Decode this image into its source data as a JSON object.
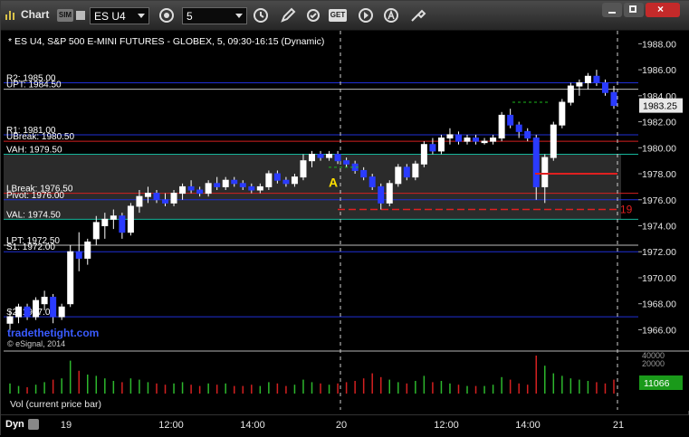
{
  "toolbar": {
    "title": "Chart",
    "symbol": "ES U4",
    "interval": "5",
    "icons": [
      "chart-icon",
      "sim-icon",
      "link-icon",
      "settings-gear-icon",
      "clock-icon",
      "pencil-icon",
      "refresh-icon",
      "get-icon",
      "play-icon",
      "alert-icon",
      "tools-icon"
    ],
    "sim_label": "SIM",
    "get_label": "GET"
  },
  "chart_data": [
    {
      "type": "candlestick",
      "title": "* ES U4, S&P 500 E-MINI FUTURES - GLOBEX, 5, 09:30-16:15 (Dynamic)",
      "last_price": "1983.25",
      "ylim": [
        1964.5,
        1989
      ],
      "y_ticks": [
        "1988.00",
        "1986.00",
        "1984.00",
        "1982.00",
        "1980.00",
        "1978.00",
        "1976.00",
        "1974.00",
        "1972.00",
        "1970.00",
        "1968.00",
        "1966.00"
      ],
      "x_ticks": [
        "19",
        "12:00",
        "14:00",
        "20",
        "12:00",
        "14:00",
        "21"
      ],
      "watermark": "tradethetight.com",
      "copyright": "© eSignal, 2014",
      "levels": [
        {
          "label": "R2: 1985.00",
          "price": 1985.0,
          "color": "#1f2fd6"
        },
        {
          "label": "UPT: 1984.50",
          "price": 1984.5,
          "color": "#bdbdbd"
        },
        {
          "label": "R1: 1981.00",
          "price": 1981.0,
          "color": "#1f2fd6"
        },
        {
          "label": "UBreak: 1980.50",
          "price": 1980.5,
          "color": "#d42020"
        },
        {
          "label": "VAH: 1979.50",
          "price": 1979.5,
          "color": "#16b49a"
        },
        {
          "label": "LBreak: 1976.50",
          "price": 1976.5,
          "color": "#d42020"
        },
        {
          "label": "Pivot: 1976.00",
          "price": 1976.0,
          "color": "#1f2fd6"
        },
        {
          "label": "VAL: 1974.50",
          "price": 1974.5,
          "color": "#16b49a"
        },
        {
          "label": "LPT: 1972.50",
          "price": 1972.5,
          "color": "#bdbdbd"
        },
        {
          "label": "S1: 1972.00",
          "price": 1972.0,
          "color": "#1f2fd6"
        },
        {
          "label": "S2: 1967.00",
          "price": 1967.0,
          "color": "#1f2fd6"
        }
      ],
      "value_area": [
        1974.5,
        1979.5
      ],
      "dashed_level_label": "19",
      "dashed_level_price": 1975.25,
      "annotation_A": "A",
      "candles": [
        [
          1966.5,
          1967.5,
          1966.0,
          1967.0
        ],
        [
          1967.0,
          1968.0,
          1966.5,
          1967.75
        ],
        [
          1967.75,
          1968.0,
          1966.75,
          1967.0
        ],
        [
          1967.0,
          1968.5,
          1966.75,
          1968.25
        ],
        [
          1968.0,
          1969.0,
          1967.5,
          1968.5
        ],
        [
          1968.5,
          1968.75,
          1966.5,
          1967.0
        ],
        [
          1967.0,
          1968.0,
          1966.75,
          1967.75
        ],
        [
          1968.0,
          1972.5,
          1967.75,
          1972.0
        ],
        [
          1972.0,
          1973.5,
          1970.5,
          1971.5
        ],
        [
          1971.5,
          1973.0,
          1971.0,
          1972.75
        ],
        [
          1973.0,
          1974.75,
          1972.5,
          1974.25
        ],
        [
          1974.0,
          1975.0,
          1973.0,
          1974.5
        ],
        [
          1974.5,
          1975.25,
          1973.75,
          1974.75
        ],
        [
          1974.75,
          1975.0,
          1973.0,
          1973.5
        ],
        [
          1973.5,
          1975.75,
          1973.25,
          1975.5
        ],
        [
          1975.5,
          1976.75,
          1975.0,
          1976.25
        ],
        [
          1976.25,
          1977.0,
          1975.75,
          1976.5
        ],
        [
          1976.5,
          1976.75,
          1975.75,
          1976.0
        ],
        [
          1976.0,
          1976.5,
          1975.5,
          1975.75
        ],
        [
          1975.75,
          1976.75,
          1975.5,
          1976.5
        ],
        [
          1976.5,
          1977.25,
          1976.0,
          1977.0
        ],
        [
          1977.0,
          1977.5,
          1976.5,
          1976.75
        ],
        [
          1976.75,
          1977.0,
          1976.25,
          1976.5
        ],
        [
          1976.5,
          1977.5,
          1976.25,
          1977.25
        ],
        [
          1977.25,
          1977.75,
          1976.75,
          1977.0
        ],
        [
          1977.0,
          1977.75,
          1976.75,
          1977.5
        ],
        [
          1977.5,
          1977.75,
          1977.0,
          1977.25
        ],
        [
          1977.25,
          1977.5,
          1976.75,
          1977.0
        ],
        [
          1977.0,
          1977.25,
          1976.5,
          1976.75
        ],
        [
          1976.75,
          1977.25,
          1976.5,
          1977.0
        ],
        [
          1977.0,
          1978.25,
          1976.75,
          1978.0
        ],
        [
          1978.0,
          1978.25,
          1977.25,
          1977.5
        ],
        [
          1977.5,
          1977.75,
          1977.0,
          1977.25
        ],
        [
          1977.25,
          1978.0,
          1977.0,
          1977.75
        ],
        [
          1977.75,
          1979.5,
          1977.5,
          1979.0
        ],
        [
          1979.0,
          1979.75,
          1978.5,
          1979.5
        ],
        [
          1979.5,
          1979.75,
          1979.0,
          1979.25
        ],
        [
          1979.25,
          1979.75,
          1979.0,
          1979.5
        ],
        [
          1979.5,
          1979.75,
          1978.75,
          1979.0
        ],
        [
          1979.0,
          1979.25,
          1978.5,
          1978.75
        ],
        [
          1978.75,
          1979.0,
          1978.0,
          1978.25
        ],
        [
          1978.25,
          1978.5,
          1977.5,
          1977.75
        ],
        [
          1977.75,
          1978.0,
          1976.75,
          1977.0
        ],
        [
          1977.0,
          1977.25,
          1975.25,
          1975.75
        ],
        [
          1975.75,
          1977.5,
          1975.5,
          1977.25
        ],
        [
          1977.25,
          1978.75,
          1977.0,
          1978.5
        ],
        [
          1978.5,
          1978.75,
          1977.5,
          1977.75
        ],
        [
          1977.75,
          1979.0,
          1977.5,
          1978.75
        ],
        [
          1978.75,
          1980.5,
          1978.5,
          1980.25
        ],
        [
          1980.25,
          1980.75,
          1979.5,
          1979.75
        ],
        [
          1979.75,
          1981.0,
          1979.5,
          1980.75
        ],
        [
          1980.75,
          1981.5,
          1980.25,
          1981.0
        ],
        [
          1981.0,
          1981.25,
          1980.25,
          1980.5
        ],
        [
          1980.5,
          1981.0,
          1980.25,
          1980.75
        ],
        [
          1980.75,
          1981.0,
          1980.25,
          1980.5
        ],
        [
          1980.5,
          1980.75,
          1980.25,
          1980.5
        ],
        [
          1980.5,
          1981.0,
          1980.25,
          1980.75
        ],
        [
          1980.75,
          1982.75,
          1980.5,
          1982.5
        ],
        [
          1982.5,
          1983.0,
          1981.5,
          1981.75
        ],
        [
          1981.75,
          1982.0,
          1980.75,
          1981.25
        ],
        [
          1981.25,
          1981.5,
          1980.5,
          1980.75
        ],
        [
          1980.75,
          1981.0,
          1976.0,
          1977.0
        ],
        [
          1977.0,
          1979.5,
          1975.75,
          1979.25
        ],
        [
          1979.25,
          1982.0,
          1979.0,
          1981.75
        ],
        [
          1981.75,
          1983.75,
          1981.5,
          1983.5
        ],
        [
          1983.5,
          1985.0,
          1983.25,
          1984.75
        ],
        [
          1984.75,
          1985.25,
          1984.0,
          1985.0
        ],
        [
          1985.0,
          1985.75,
          1984.5,
          1985.5
        ],
        [
          1985.5,
          1986.0,
          1984.75,
          1985.0
        ],
        [
          1985.0,
          1985.25,
          1984.0,
          1984.25
        ],
        [
          1984.25,
          1984.75,
          1983.0,
          1983.25
        ]
      ],
      "volume_pane": {
        "label": "Vol (current price bar)",
        "value": "11066",
        "ylim": [
          0,
          45000
        ],
        "y_ticks": [
          "40000",
          "20000"
        ],
        "values": [
          8,
          6,
          5,
          7,
          9,
          11,
          12,
          26,
          18,
          15,
          14,
          12,
          10,
          9,
          12,
          11,
          9,
          8,
          7,
          8,
          9,
          7,
          6,
          8,
          7,
          8,
          6,
          6,
          7,
          6,
          9,
          8,
          6,
          7,
          11,
          9,
          8,
          7,
          8,
          9,
          10,
          12,
          16,
          13,
          11,
          9,
          8,
          10,
          14,
          9,
          10,
          8,
          7,
          6,
          6,
          6,
          7,
          13,
          11,
          8,
          7,
          30,
          22,
          16,
          14,
          12,
          11,
          10,
          9,
          8,
          11
        ],
        "colors": [
          "#2db82d",
          "#d42020"
        ]
      }
    }
  ],
  "statusbar": {
    "label": "Dyn",
    "x_ticks": [
      "19",
      "12:00",
      "14:00",
      "20",
      "12:00",
      "14:00",
      "21"
    ]
  }
}
